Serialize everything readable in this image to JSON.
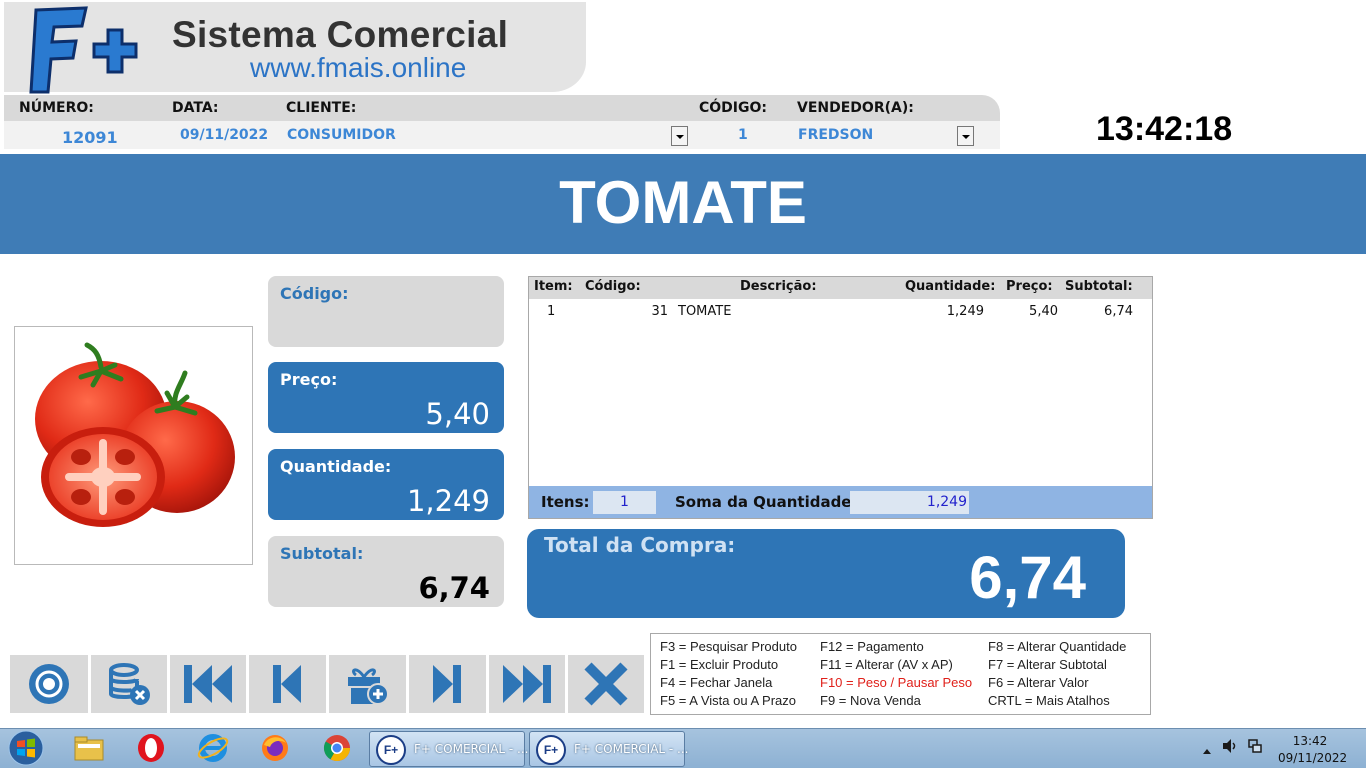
{
  "brand": {
    "logo_text": "F+",
    "title": "Sistema Comercial",
    "url": "www.fmais.online"
  },
  "header": {
    "labels": {
      "numero": "NÚMERO:",
      "data": "DATA:",
      "cliente": "CLIENTE:",
      "codigo": "CÓDIGO:",
      "vendedor": "VENDEDOR(A):"
    },
    "values": {
      "numero": "12091",
      "data": "09/11/2022",
      "cliente": "CONSUMIDOR",
      "codigo": "1",
      "vendedor": "FREDSON"
    }
  },
  "clock": "13:42:18",
  "product": {
    "name": "TOMATE",
    "image_icon": "tomato-image"
  },
  "fields": {
    "codigo": {
      "label": "Código:",
      "value": ""
    },
    "preco": {
      "label": "Preço:",
      "value": "5,40"
    },
    "quantidade": {
      "label": "Quantidade:",
      "value": "1,249"
    },
    "subtotal": {
      "label": "Subtotal:",
      "value": "6,74"
    }
  },
  "items_table": {
    "columns": [
      "Item:",
      "Código:",
      "Descrição:",
      "Quantidade:",
      "Preço:",
      "Subtotal:"
    ],
    "rows": [
      {
        "item": "1",
        "codigo": "31",
        "descricao": "TOMATE",
        "quantidade": "1,249",
        "preco": "5,40",
        "subtotal": "6,74"
      }
    ],
    "footer": {
      "itens_label": "Itens:",
      "itens_value": "1",
      "soma_label": "Soma da Quantidade:",
      "soma_value": "1,249"
    }
  },
  "total": {
    "label": "Total da Compra:",
    "value": "6,74"
  },
  "toolbar": {
    "buttons": [
      "record-icon",
      "delete-database-icon",
      "first-record-icon",
      "previous-record-icon",
      "add-item-icon",
      "next-record-icon",
      "last-record-icon",
      "close-icon"
    ]
  },
  "shortcuts": {
    "col1": [
      "F3 = Pesquisar Produto",
      "F1 = Excluir Produto",
      "F4 = Fechar Janela",
      "F5 = A Vista ou A Prazo"
    ],
    "col2": [
      "F12 = Pagamento",
      "F11 = Alterar (AV x AP)",
      "F10 = Peso / Pausar Peso",
      "F9 = Nova Venda"
    ],
    "col3": [
      "F8 = Alterar Quantidade",
      "F7 = Alterar Subtotal",
      "F6 = Alterar Valor",
      "CRTL = Mais Atalhos"
    ]
  },
  "taskbar": {
    "tasks": [
      "F+ COMERCIAL - ...",
      "F+ COMERCIAL - ..."
    ],
    "task_icon": "F+",
    "time": "13:42",
    "date": "09/11/2022"
  },
  "colors": {
    "primary_blue": "#2e75b6",
    "banner_blue": "#3f7cb6",
    "header_value_blue": "#3d87d6",
    "panel_grey": "#d9d9d9",
    "shortcut_red": "#e0201a"
  }
}
